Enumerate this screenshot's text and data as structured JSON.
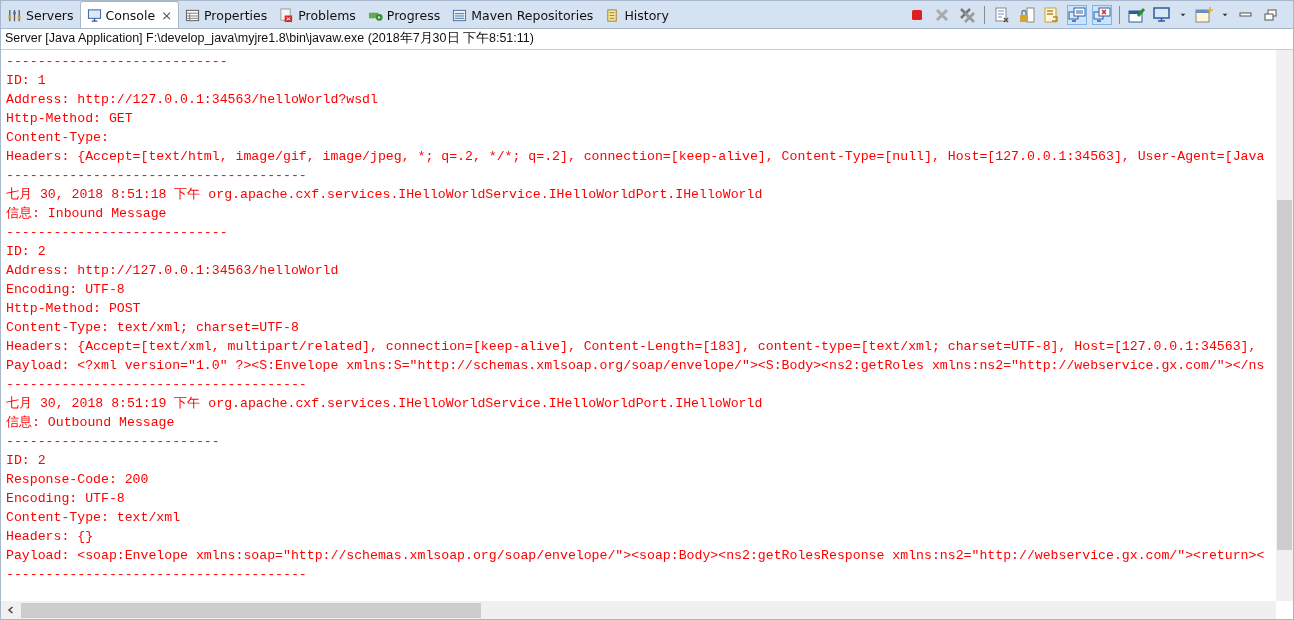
{
  "tabs": [
    {
      "label": "Servers",
      "kind": "servers",
      "selected": false
    },
    {
      "label": "Console",
      "kind": "console",
      "selected": true,
      "close": "⨯"
    },
    {
      "label": "Properties",
      "kind": "properties",
      "selected": false
    },
    {
      "label": "Problems",
      "kind": "problems",
      "selected": false
    },
    {
      "label": "Progress",
      "kind": "progress",
      "selected": false
    },
    {
      "label": "Maven Repositories",
      "kind": "maven",
      "selected": false
    },
    {
      "label": "History",
      "kind": "history",
      "selected": false
    }
  ],
  "toolbar": [
    {
      "buttons": [
        {
          "kind": "terminate"
        },
        {
          "kind": "remove"
        },
        {
          "kind": "remove-all"
        }
      ]
    },
    {
      "buttons": [
        {
          "kind": "clear"
        },
        {
          "kind": "lock"
        },
        {
          "kind": "wrap"
        },
        {
          "kind": "stdout",
          "on": true
        },
        {
          "kind": "stderr",
          "on": true
        }
      ]
    },
    {
      "buttons": [
        {
          "kind": "pin"
        },
        {
          "kind": "display"
        },
        {
          "kind": "drop"
        },
        {
          "kind": "new"
        },
        {
          "kind": "drop"
        },
        {
          "kind": "minimize"
        },
        {
          "kind": "maximize"
        }
      ]
    }
  ],
  "console": {
    "description": "Server [Java Application] F:\\develop_java\\myjre1.8\\bin\\javaw.exe (2018年7月30日 下午8:51:11)",
    "lines": [
      "----------------------------",
      "ID: 1",
      "Address: http://127.0.0.1:34563/helloWorld?wsdl",
      "Http-Method: GET",
      "Content-Type: ",
      "Headers: {Accept=[text/html, image/gif, image/jpeg, *; q=.2, */*; q=.2], connection=[keep-alive], Content-Type=[null], Host=[127.0.0.1:34563], User-Agent=[Java",
      "--------------------------------------",
      "七月 30, 2018 8:51:18 下午 org.apache.cxf.services.IHelloWorldService.IHelloWorldPort.IHelloWorld",
      "信息: Inbound Message",
      "----------------------------",
      "ID: 2",
      "Address: http://127.0.0.1:34563/helloWorld",
      "Encoding: UTF-8",
      "Http-Method: POST",
      "Content-Type: text/xml; charset=UTF-8",
      "Headers: {Accept=[text/xml, multipart/related], connection=[keep-alive], Content-Length=[183], content-type=[text/xml; charset=UTF-8], Host=[127.0.0.1:34563],",
      "Payload: <?xml version=\"1.0\" ?><S:Envelope xmlns:S=\"http://schemas.xmlsoap.org/soap/envelope/\"><S:Body><ns2:getRoles xmlns:ns2=\"http://webservice.gx.com/\"></ns",
      "--------------------------------------",
      "七月 30, 2018 8:51:19 下午 org.apache.cxf.services.IHelloWorldService.IHelloWorldPort.IHelloWorld",
      "信息: Outbound Message",
      "---------------------------",
      "ID: 2",
      "Response-Code: 200",
      "Encoding: UTF-8",
      "Content-Type: text/xml",
      "Headers: {}",
      "Payload: <soap:Envelope xmlns:soap=\"http://schemas.xmlsoap.org/soap/envelope/\"><soap:Body><ns2:getRolesResponse xmlns:ns2=\"http://webservice.gx.com/\"><return><",
      "--------------------------------------"
    ]
  }
}
